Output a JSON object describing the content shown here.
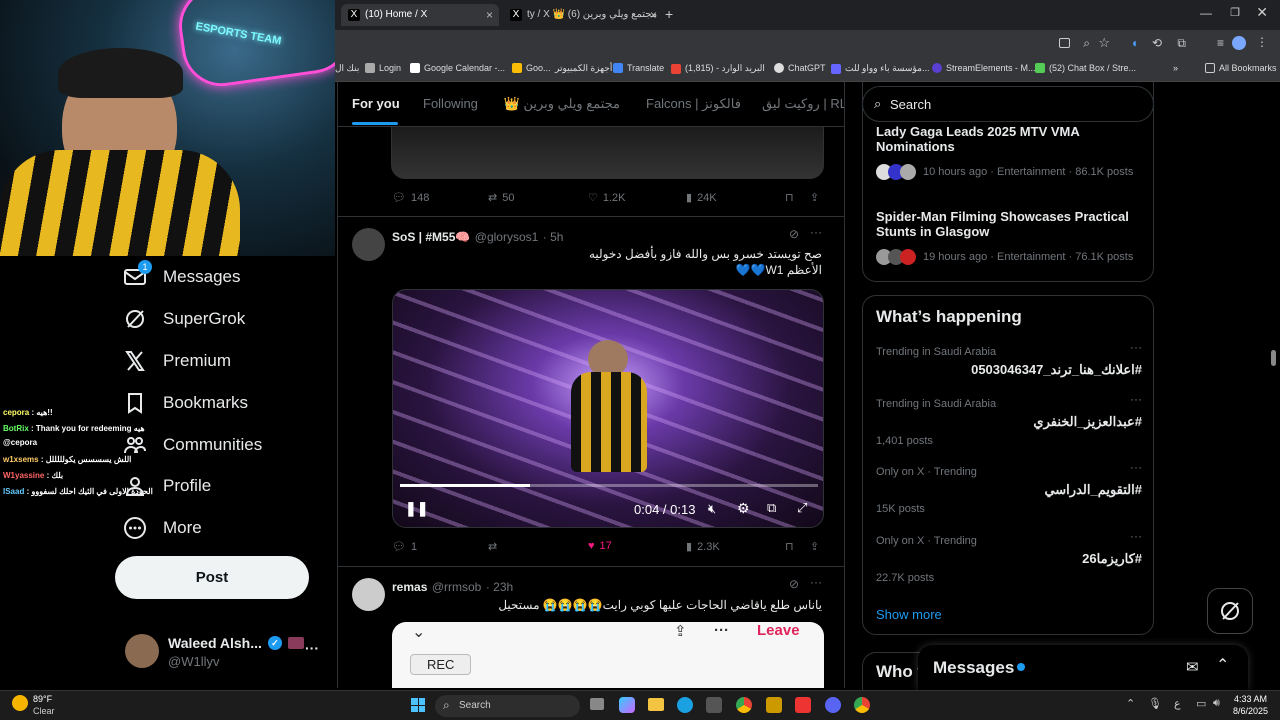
{
  "browser": {
    "tabs": [
      {
        "label": "(10) Home / X",
        "active": true
      },
      {
        "label": "ty / X 👑 مجتمع ويلي وبرين (6)",
        "active": false
      }
    ],
    "new_tab": "+",
    "bookmarks": [
      "بنك ال",
      "Login",
      "Google Calendar -...",
      "Goo...",
      "أجهزة الكمبيوتر",
      "Translate",
      "البريد الوارد - (1,815)",
      "ChatGPT",
      "مؤسسة باء وواو للت...",
      "StreamElements - M...",
      "(52) Chat Box / Stre..."
    ],
    "all_bookmarks": "All Bookmarks"
  },
  "chat_overlay": [
    {
      "user": "cepora",
      "msg": ": هيه!!"
    },
    {
      "user": "BotRix",
      "msg": ": Thank you for redeeming هيه"
    },
    {
      "user": "@cepora",
      "msg": ""
    },
    {
      "user": "w1xsems",
      "msg": ": اللش يسسسس يكولللللل"
    },
    {
      "user": "W1yassine",
      "msg": ": بلك"
    },
    {
      "user": "ISaad",
      "msg": ": الحودة الاولى في الثيك احلك لسفووو"
    }
  ],
  "nav": {
    "messages": "Messages",
    "messages_badge": "1",
    "supergrok": "SuperGrok",
    "premium": "Premium",
    "bookmarks": "Bookmarks",
    "communities": "Communities",
    "profile": "Profile",
    "more": "More",
    "post": "Post"
  },
  "account": {
    "name": "Waleed Alsh...",
    "handle": "@W1llyv",
    "more": "···"
  },
  "feed": {
    "tabs": [
      "For you",
      "Following",
      "مجتمع ويلي وبرين 👑",
      "Falcons | فالكونز",
      "روكيت ليق | RL"
    ],
    "post0": {
      "replies": "148",
      "reposts": "50",
      "likes": "1.2K",
      "views": "24K"
    },
    "post1": {
      "name": "SoS | #M55🧠",
      "handle": "@glorysos1",
      "time": "· 5h",
      "text1": "صح تويستد خسرو بس والله فازو بأفضل دخوليه",
      "text2": "الأعظم W1💙💙",
      "video_time": "0:04 / 0:13",
      "video_progress": 0.31,
      "replies": "1",
      "reposts": "",
      "likes": "17",
      "views": "2.3K"
    },
    "post2": {
      "name": "remas",
      "handle": "@rrmsob",
      "time": "· 23h",
      "text": "ياناس طلع ياقاضي الحاجات عليها كوبي رايت😭😭😭😭 مستحيل",
      "leave": "Leave",
      "rec": "REC"
    }
  },
  "right": {
    "search_placeholder": "Search",
    "news": [
      {
        "title": "Lady Gaga Leads 2025 MTV VMA Nominations",
        "meta": "10 hours ago · Entertainment · 86.1K posts"
      },
      {
        "title": "Spider-Man Filming Showcases Practical Stunts in Glasgow",
        "meta": "19 hours ago · Entertainment · 76.1K posts"
      }
    ],
    "whats_happening": "What’s happening",
    "trends": [
      {
        "context": "Trending in Saudi Arabia",
        "name": "#اعلانك_هنا_ترند_0503046347",
        "posts": ""
      },
      {
        "context": "Trending in Saudi Arabia",
        "name": "#عبدالعزيز_الخنفري",
        "posts": "1,401 posts"
      },
      {
        "context": "Only on X · Trending",
        "name": "#التقويم_الدراسي",
        "posts": "15K posts"
      },
      {
        "context": "Only on X · Trending",
        "name": "#كاريزما26",
        "posts": "22.7K posts"
      }
    ],
    "show_more": "Show more",
    "who_to_follow": "Who t",
    "messages_drawer": "Messages"
  },
  "taskbar": {
    "weather_temp": "89°F",
    "weather_desc": "Clear",
    "search": "Search",
    "time": "4:33 AM",
    "date": "8/6/2025",
    "lang": "ع"
  },
  "colors": {
    "accent": "#1d9bf0",
    "like": "#f91880",
    "bg": "#000000",
    "border": "#2f3336"
  }
}
